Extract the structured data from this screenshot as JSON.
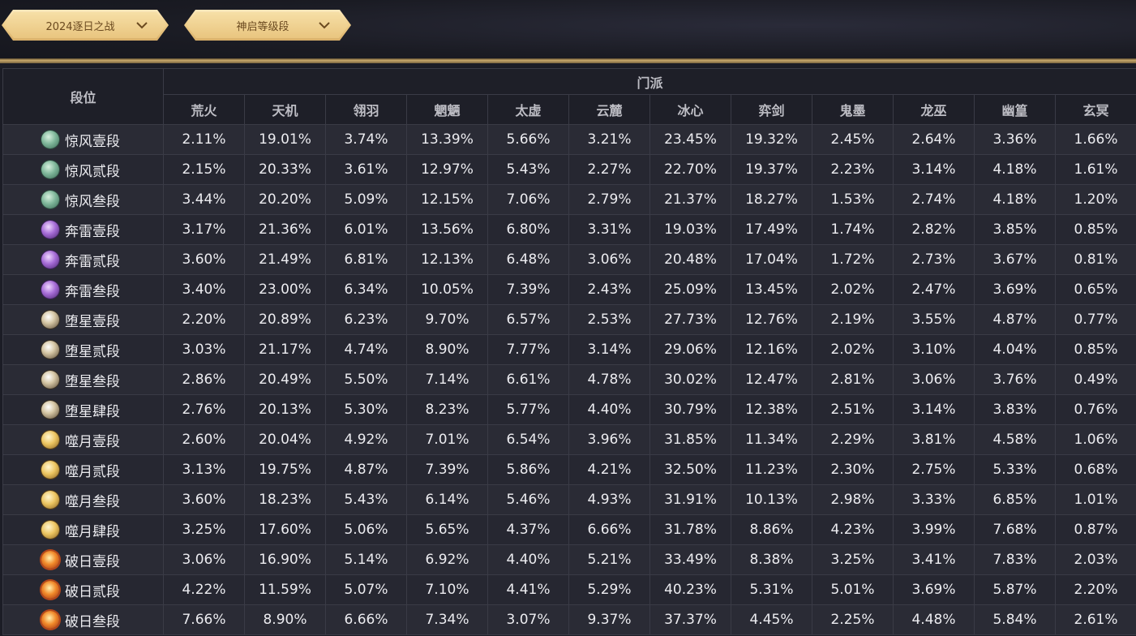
{
  "filters": {
    "season": {
      "label": "2024逐日之战",
      "icon": "chevron-down-icon"
    },
    "tier": {
      "label": "神启等级段",
      "icon": "chevron-down-icon"
    }
  },
  "table": {
    "rank_header": "段位",
    "group_header": "门派",
    "sects": [
      "荒火",
      "天机",
      "翎羽",
      "魍魉",
      "太虚",
      "云麓",
      "冰心",
      "弈剑",
      "鬼墨",
      "龙巫",
      "幽篁",
      "玄冥"
    ],
    "rows": [
      {
        "rank": "惊风壹段",
        "medal": "jingfeng-medal-icon",
        "values": [
          "2.11%",
          "19.01%",
          "3.74%",
          "13.39%",
          "5.66%",
          "3.21%",
          "23.45%",
          "19.32%",
          "2.45%",
          "2.64%",
          "3.36%",
          "1.66%"
        ]
      },
      {
        "rank": "惊风贰段",
        "medal": "jingfeng-medal-icon",
        "values": [
          "2.15%",
          "20.33%",
          "3.61%",
          "12.97%",
          "5.43%",
          "2.27%",
          "22.70%",
          "19.37%",
          "2.23%",
          "3.14%",
          "4.18%",
          "1.61%"
        ]
      },
      {
        "rank": "惊风叁段",
        "medal": "jingfeng-medal-icon",
        "values": [
          "3.44%",
          "20.20%",
          "5.09%",
          "12.15%",
          "7.06%",
          "2.79%",
          "21.37%",
          "18.27%",
          "1.53%",
          "2.74%",
          "4.18%",
          "1.20%"
        ]
      },
      {
        "rank": "奔雷壹段",
        "medal": "benlei-medal-icon",
        "values": [
          "3.17%",
          "21.36%",
          "6.01%",
          "13.56%",
          "6.80%",
          "3.31%",
          "19.03%",
          "17.49%",
          "1.74%",
          "2.82%",
          "3.85%",
          "0.85%"
        ]
      },
      {
        "rank": "奔雷贰段",
        "medal": "benlei-medal-icon",
        "values": [
          "3.60%",
          "21.49%",
          "6.81%",
          "12.13%",
          "6.48%",
          "3.06%",
          "20.48%",
          "17.04%",
          "1.72%",
          "2.73%",
          "3.67%",
          "0.81%"
        ]
      },
      {
        "rank": "奔雷叁段",
        "medal": "benlei-medal-icon",
        "values": [
          "3.40%",
          "23.00%",
          "6.34%",
          "10.05%",
          "7.39%",
          "2.43%",
          "25.09%",
          "13.45%",
          "2.02%",
          "2.47%",
          "3.69%",
          "0.65%"
        ]
      },
      {
        "rank": "堕星壹段",
        "medal": "duoxing-medal-icon",
        "values": [
          "2.20%",
          "20.89%",
          "6.23%",
          "9.70%",
          "6.57%",
          "2.53%",
          "27.73%",
          "12.76%",
          "2.19%",
          "3.55%",
          "4.87%",
          "0.77%"
        ]
      },
      {
        "rank": "堕星贰段",
        "medal": "duoxing-medal-icon",
        "values": [
          "3.03%",
          "21.17%",
          "4.74%",
          "8.90%",
          "7.77%",
          "3.14%",
          "29.06%",
          "12.16%",
          "2.02%",
          "3.10%",
          "4.04%",
          "0.85%"
        ]
      },
      {
        "rank": "堕星叁段",
        "medal": "duoxing-medal-icon",
        "values": [
          "2.86%",
          "20.49%",
          "5.50%",
          "7.14%",
          "6.61%",
          "4.78%",
          "30.02%",
          "12.47%",
          "2.81%",
          "3.06%",
          "3.76%",
          "0.49%"
        ]
      },
      {
        "rank": "堕星肆段",
        "medal": "duoxing-medal-icon",
        "values": [
          "2.76%",
          "20.13%",
          "5.30%",
          "8.23%",
          "5.77%",
          "4.40%",
          "30.79%",
          "12.38%",
          "2.51%",
          "3.14%",
          "3.83%",
          "0.76%"
        ]
      },
      {
        "rank": "噬月壹段",
        "medal": "shiyue-medal-icon",
        "values": [
          "2.60%",
          "20.04%",
          "4.92%",
          "7.01%",
          "6.54%",
          "3.96%",
          "31.85%",
          "11.34%",
          "2.29%",
          "3.81%",
          "4.58%",
          "1.06%"
        ]
      },
      {
        "rank": "噬月贰段",
        "medal": "shiyue-medal-icon",
        "values": [
          "3.13%",
          "19.75%",
          "4.87%",
          "7.39%",
          "5.86%",
          "4.21%",
          "32.50%",
          "11.23%",
          "2.30%",
          "2.75%",
          "5.33%",
          "0.68%"
        ]
      },
      {
        "rank": "噬月叁段",
        "medal": "shiyue-medal-icon",
        "values": [
          "3.60%",
          "18.23%",
          "5.43%",
          "6.14%",
          "5.46%",
          "4.93%",
          "31.91%",
          "10.13%",
          "2.98%",
          "3.33%",
          "6.85%",
          "1.01%"
        ]
      },
      {
        "rank": "噬月肆段",
        "medal": "shiyue-medal-icon",
        "values": [
          "3.25%",
          "17.60%",
          "5.06%",
          "5.65%",
          "4.37%",
          "6.66%",
          "31.78%",
          "8.86%",
          "4.23%",
          "3.99%",
          "7.68%",
          "0.87%"
        ]
      },
      {
        "rank": "破日壹段",
        "medal": "pori-medal-icon",
        "values": [
          "3.06%",
          "16.90%",
          "5.14%",
          "6.92%",
          "4.40%",
          "5.21%",
          "33.49%",
          "8.38%",
          "3.25%",
          "3.41%",
          "7.83%",
          "2.03%"
        ]
      },
      {
        "rank": "破日贰段",
        "medal": "pori-medal-icon",
        "values": [
          "4.22%",
          "11.59%",
          "5.07%",
          "7.10%",
          "4.41%",
          "5.29%",
          "40.23%",
          "5.31%",
          "5.01%",
          "3.69%",
          "5.87%",
          "2.20%"
        ]
      },
      {
        "rank": "破日叁段",
        "medal": "pori-medal-icon",
        "values": [
          "7.66%",
          "8.90%",
          "6.66%",
          "7.34%",
          "3.07%",
          "9.37%",
          "37.37%",
          "4.45%",
          "2.25%",
          "4.48%",
          "5.84%",
          "2.61%"
        ]
      }
    ]
  },
  "colors": {
    "background": "#1c1d26",
    "header_bg": "#1e1f28",
    "row_bg": "#2a2b35",
    "border": "#3a3b46",
    "gold_accent": "#e9c57f"
  }
}
